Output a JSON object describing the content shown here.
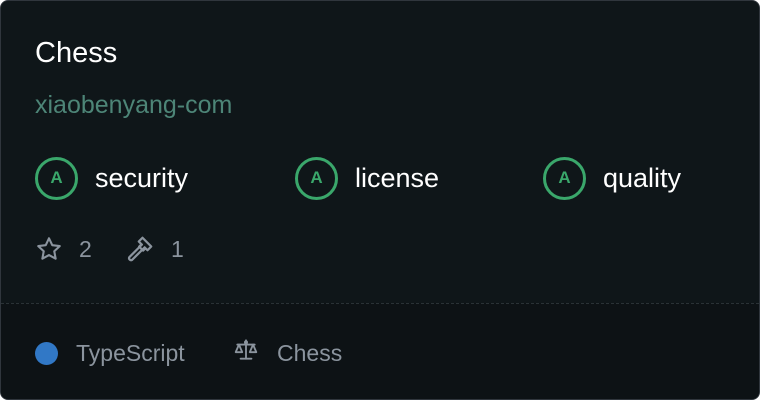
{
  "repo": {
    "name": "Chess",
    "owner": "xiaobenyang-com"
  },
  "scores": [
    {
      "grade": "A",
      "label": "security"
    },
    {
      "grade": "A",
      "label": "license"
    },
    {
      "grade": "A",
      "label": "quality"
    }
  ],
  "stats": {
    "stars": "2",
    "forks": "1",
    "star_icon": "star-icon",
    "hammer_icon": "hammer-icon"
  },
  "footer": {
    "language": "TypeScript",
    "language_color": "#3178c6",
    "license": "Chess",
    "license_icon": "scale-icon"
  },
  "colors": {
    "grade": "#3aa76b",
    "owner": "#4d8577",
    "background": "#0f1619"
  }
}
